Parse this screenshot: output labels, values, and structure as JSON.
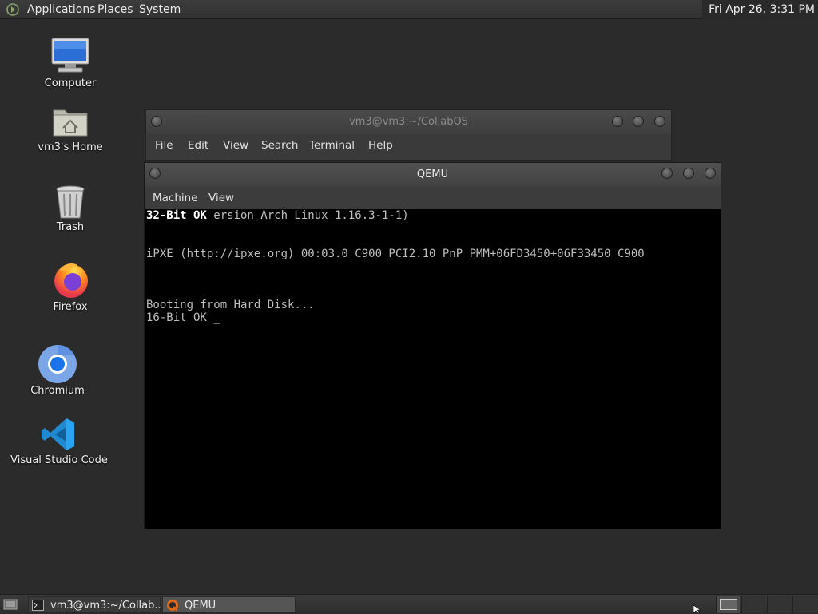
{
  "top_panel": {
    "menus": [
      "Applications",
      "Places",
      "System"
    ],
    "clock": "Fri Apr 26,  3:31 PM"
  },
  "desktop_icons": [
    {
      "label": "Computer",
      "icon": "computer-icon"
    },
    {
      "label": "vm3's Home",
      "icon": "home-folder-icon"
    },
    {
      "label": "Trash",
      "icon": "trash-icon"
    },
    {
      "label": "Firefox",
      "icon": "firefox-icon"
    },
    {
      "label": "Chromium",
      "icon": "chromium-icon"
    },
    {
      "label": "Visual Studio Code",
      "icon": "vscode-icon"
    }
  ],
  "terminal_window": {
    "title": "vm3@vm3:~/CollabOS",
    "menus": [
      "File",
      "Edit",
      "View",
      "Search",
      "Terminal",
      "Help"
    ]
  },
  "qemu_window": {
    "title": "QEMU",
    "menus": [
      "Machine",
      "View"
    ],
    "console": {
      "line1_highlight": "32-Bit OK",
      "line1_rest": " ersion Arch Linux 1.16.3-1-1)",
      "line2": "iPXE (http://ipxe.org) 00:03.0 C900 PCI2.10 PnP PMM+06FD3450+06F33450 C900",
      "line3": "Booting from Hard Disk...",
      "line4": "16-Bit OK _"
    }
  },
  "taskbar": {
    "tasks": [
      {
        "label": "vm3@vm3:~/Collab...",
        "icon": "terminal-icon"
      },
      {
        "label": "QEMU",
        "icon": "qemu-icon"
      }
    ]
  },
  "colors": {
    "desktop_bg": "#2b2b2b",
    "panel_bg": "#353535",
    "console_bg": "#000000",
    "console_fg": "#bdbdbd"
  }
}
